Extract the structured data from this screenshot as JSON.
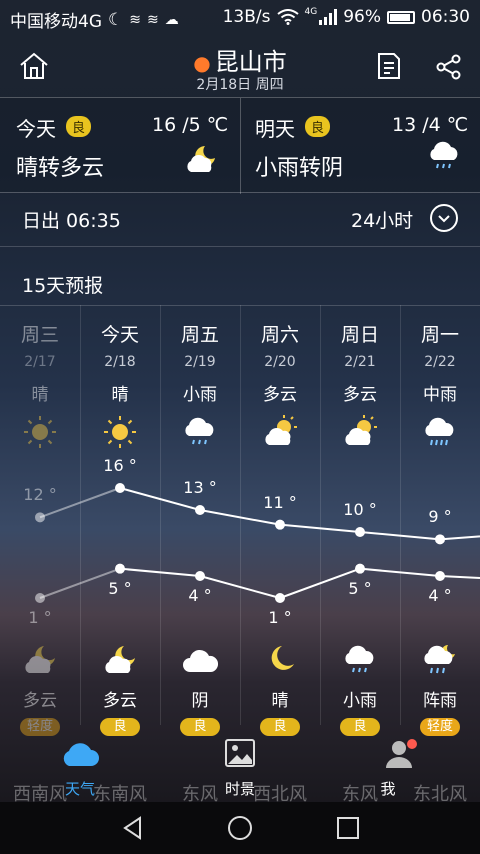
{
  "status": {
    "carrier": "中国移动4G",
    "speed": "13B/s",
    "battery": "96%",
    "time": "06:30",
    "net": "4G"
  },
  "header": {
    "city": "昆山市",
    "date": "2月18日 周四"
  },
  "today": {
    "label": "今天",
    "aq": "良",
    "temp": "16 /5 ℃",
    "desc": "晴转多云",
    "icon": "partly-cloudy-icon"
  },
  "tomorrow": {
    "label": "明天",
    "aq": "良",
    "temp": "13 /4 ℃",
    "desc": "小雨转阴",
    "icon": "light-rain-icon"
  },
  "sunrise": "日出 06:35",
  "hours_label": "24小时",
  "forecast_title": "15天预报",
  "days": [
    {
      "name": "周三",
      "date": "2/17",
      "day_weather": "晴",
      "high": "12 °",
      "low": "1 °",
      "night_weather": "多云",
      "aq": "轻度",
      "wind": "西南风",
      "day_icon": "sun-icon",
      "night_icon": "cloudy-night-icon"
    },
    {
      "name": "今天",
      "date": "2/18",
      "day_weather": "晴",
      "high": "16 °",
      "low": "5 °",
      "night_weather": "多云",
      "aq": "良",
      "wind": "东南风",
      "day_icon": "sun-icon",
      "night_icon": "cloudy-night-icon"
    },
    {
      "name": "周五",
      "date": "2/19",
      "day_weather": "小雨",
      "high": "13 °",
      "low": "4 °",
      "night_weather": "阴",
      "aq": "良",
      "wind": "东风",
      "day_icon": "light-rain-icon",
      "night_icon": "overcast-icon"
    },
    {
      "name": "周六",
      "date": "2/20",
      "day_weather": "多云",
      "high": "11 °",
      "low": "1 °",
      "night_weather": "晴",
      "aq": "良",
      "wind": "西北风",
      "day_icon": "partly-cloudy-icon",
      "night_icon": "moon-icon"
    },
    {
      "name": "周日",
      "date": "2/21",
      "day_weather": "多云",
      "high": "10 °",
      "low": "5 °",
      "night_weather": "小雨",
      "aq": "良",
      "wind": "东风",
      "day_icon": "partly-cloudy-icon",
      "night_icon": "light-rain-icon"
    },
    {
      "name": "周一",
      "date": "2/22",
      "day_weather": "中雨",
      "high": "9 °",
      "low": "4 °",
      "night_weather": "阵雨",
      "aq": "轻度",
      "wind": "东北风",
      "day_icon": "moderate-rain-icon",
      "night_icon": "shower-icon"
    }
  ],
  "chart_data": {
    "type": "line",
    "categories": [
      "2/17",
      "2/18",
      "2/19",
      "2/20",
      "2/21",
      "2/22"
    ],
    "series": [
      {
        "values": [
          12,
          16,
          13,
          11,
          10,
          9
        ]
      },
      {
        "values": [
          1,
          5,
          4,
          1,
          5,
          4
        ]
      }
    ]
  },
  "tabs": [
    {
      "label": "天气",
      "icon": "cloud-icon",
      "active": true
    },
    {
      "label": "时景",
      "icon": "picture-icon",
      "active": false
    },
    {
      "label": "我",
      "icon": "person-icon",
      "active": false
    }
  ],
  "colors": {
    "accent": "#3ea8f5",
    "aq_good": "#e3b51c",
    "aq_light": "#e9a719",
    "pin": "#ff7a2b"
  }
}
